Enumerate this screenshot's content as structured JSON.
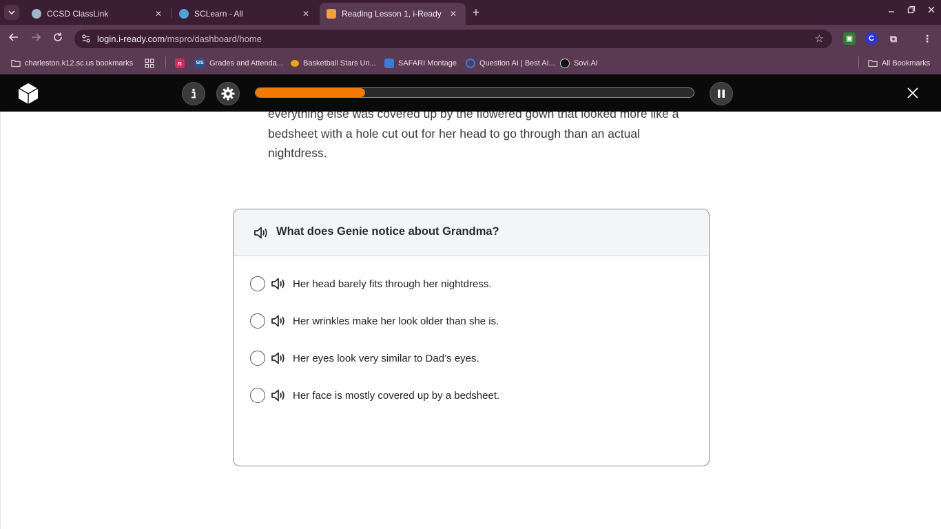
{
  "browser": {
    "tabs": [
      {
        "title": "CCSD ClassLink",
        "active": false,
        "favicon_color": "#9fb7c9"
      },
      {
        "title": "SCLearn - All",
        "active": false,
        "favicon_color": "#4da3d9"
      },
      {
        "title": "Reading Lesson 1, i-Ready",
        "active": true,
        "favicon_color": "#f2a03d"
      }
    ],
    "address": {
      "host": "login.i-ready.com",
      "path": "/mspro/dashboard/home"
    },
    "bookmarks": [
      {
        "label": "charleston.k12.sc.us bookmarks",
        "icon": "folder-icon"
      },
      {
        "label": "",
        "icon": "apps-grid-icon"
      },
      {
        "label": "",
        "icon": "n-logo-icon",
        "color": "#e0245e",
        "glyph": "n"
      },
      {
        "label": "Grades and Attenda...",
        "icon": "sis-icon",
        "color": "#2d4f8c",
        "glyph": "SIS"
      },
      {
        "label": "Basketball Stars Un...",
        "icon": "basketball-icon",
        "color": "#e8a317"
      },
      {
        "label": "SAFARI Montage",
        "icon": "safari-montage-icon",
        "color": "#3a7bd5"
      },
      {
        "label": "Question AI | Best AI...",
        "icon": "question-ai-icon",
        "color": "#2e7df0"
      },
      {
        "label": "Sovi.AI",
        "icon": "sovi-icon",
        "color": "#111111"
      },
      {
        "label": "All Bookmarks",
        "icon": "folder-icon"
      }
    ]
  },
  "app": {
    "progress_fraction": 0.25,
    "accent_color": "#f27a00"
  },
  "passage": {
    "text": "everything else was covered up by the flowered gown that looked more like a bedsheet with a hole cut out for her head to go through than an actual nightdress."
  },
  "question": {
    "prompt": "What does Genie notice about Grandma?",
    "options": [
      "Her head barely fits through her nightdress.",
      "Her wrinkles make her look older than she is.",
      "Her eyes look very similar to Dad’s eyes.",
      "Her face is mostly covered up by a bedsheet."
    ]
  }
}
